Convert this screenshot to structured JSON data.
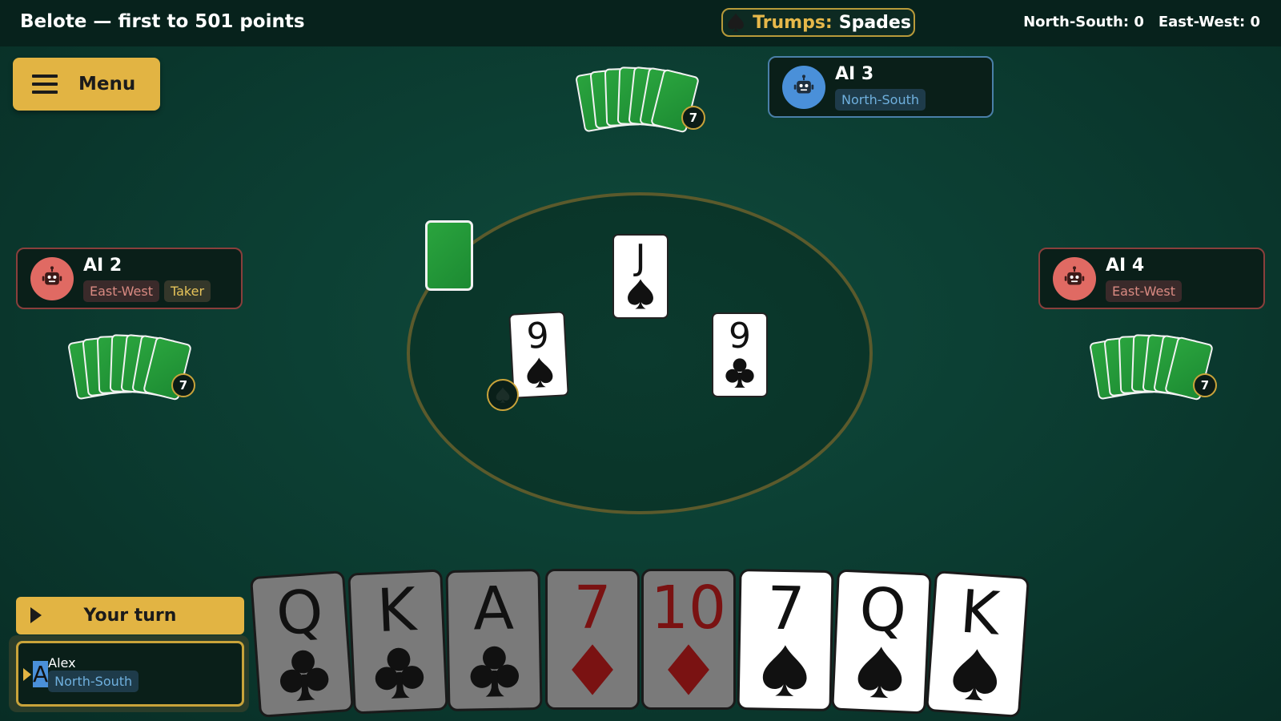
{
  "header": {
    "title": "Belote — first to 501 points",
    "trumps_label": "Trumps:",
    "trumps_value": "Spades",
    "trumps_icon": "spade-icon",
    "score_ns": "North-South: 0",
    "score_ew": "East-West: 0"
  },
  "menu": {
    "label": "Menu",
    "icon": "hamburger-icon"
  },
  "players": {
    "north": {
      "name": "AI 3",
      "team": "North-South",
      "avatar": "robot-icon",
      "avatar_color": "#4a90d9",
      "cards": "7"
    },
    "west": {
      "name": "AI 2",
      "team": "East-West",
      "role": "Taker",
      "avatar": "robot-icon",
      "avatar_color": "#e06a63",
      "cards": "7"
    },
    "east": {
      "name": "AI 4",
      "team": "East-West",
      "avatar": "robot-icon",
      "avatar_color": "#e06a63",
      "cards": "7"
    },
    "south": {
      "name": "Alex",
      "team": "North-South",
      "avatar_letter": "A",
      "avatar_color": "#4a90d9"
    }
  },
  "trick": [
    {
      "rank": "J",
      "suit": "spade"
    },
    {
      "rank": "9",
      "suit": "spade"
    },
    {
      "rank": "9",
      "suit": "club"
    }
  ],
  "turn": {
    "label": "Your turn"
  },
  "hand": [
    {
      "rank": "Q",
      "suit": "club",
      "playable": false
    },
    {
      "rank": "K",
      "suit": "club",
      "playable": false
    },
    {
      "rank": "A",
      "suit": "club",
      "playable": false
    },
    {
      "rank": "7",
      "suit": "diamond",
      "playable": false
    },
    {
      "rank": "10",
      "suit": "diamond",
      "playable": false
    },
    {
      "rank": "7",
      "suit": "spade",
      "playable": true
    },
    {
      "rank": "Q",
      "suit": "spade",
      "playable": true
    },
    {
      "rank": "K",
      "suit": "spade",
      "playable": true
    }
  ],
  "colors": {
    "accent": "#e2b443",
    "felt": "#0b3b30",
    "north_south": "#6fb0de",
    "east_west": "#d98a82",
    "diamond": "#7a1212"
  }
}
